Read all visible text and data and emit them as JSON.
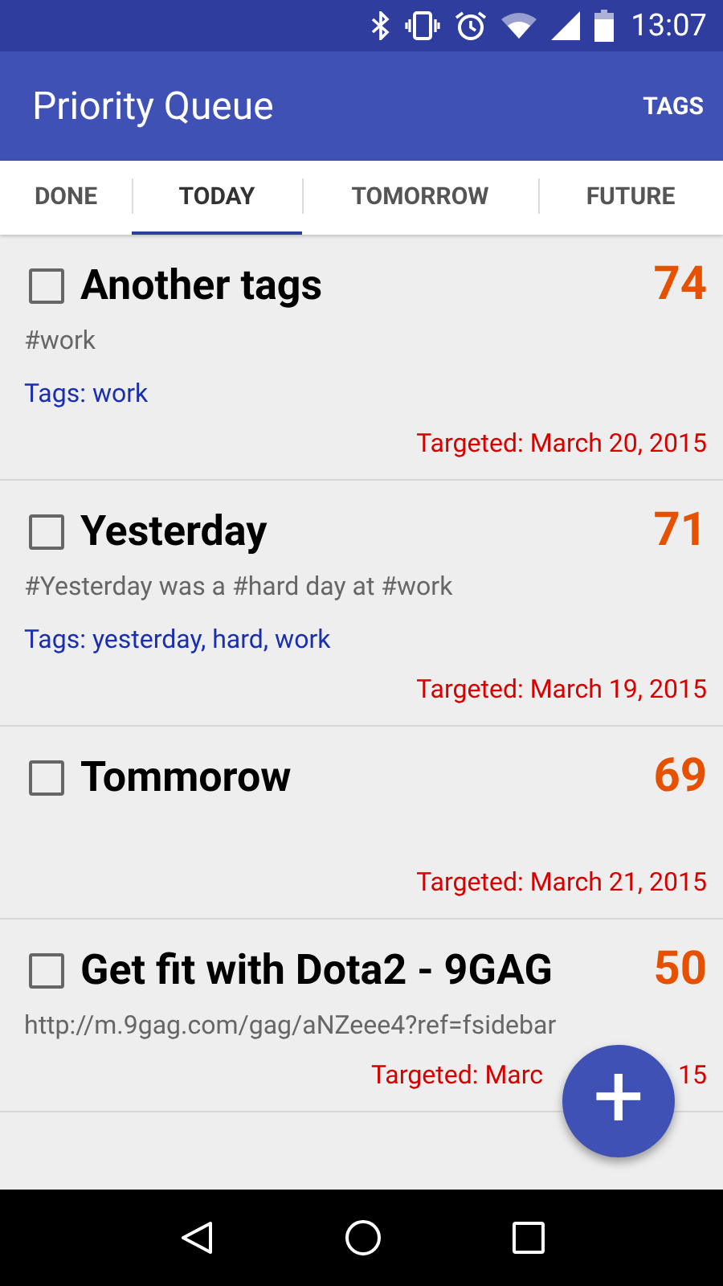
{
  "status_bar": {
    "time": "13:07"
  },
  "app_bar": {
    "title": "Priority Queue",
    "action": "TAGS"
  },
  "tabs": [
    {
      "label": "DONE",
      "selected": false
    },
    {
      "label": "TODAY",
      "selected": true
    },
    {
      "label": "TOMORROW",
      "selected": false
    },
    {
      "label": "FUTURE",
      "selected": false
    }
  ],
  "tasks": [
    {
      "title": "Another tags",
      "checked": false,
      "score": "74",
      "description": "#work",
      "tags": "Tags: work",
      "target": [
        "Targeted: March 20, 2015"
      ]
    },
    {
      "title": "Yesterday",
      "checked": false,
      "score": "71",
      "description": "#Yesterday was a #hard day at #work",
      "tags": "Tags: yesterday, hard, work",
      "target": [
        "Targeted: March 19, 2015"
      ]
    },
    {
      "title": "Tommorow",
      "checked": false,
      "score": "69",
      "target": [
        "Targeted: March 21, 2015"
      ]
    },
    {
      "title": "Get fit with Dota2 - 9GAG",
      "checked": false,
      "score": "50",
      "description": "http://m.9gag.com/gag/aNZeee4?ref=fsidebar",
      "target": [
        "Targeted: Marc",
        "15"
      ]
    }
  ],
  "fab": {
    "symbol": "+"
  }
}
